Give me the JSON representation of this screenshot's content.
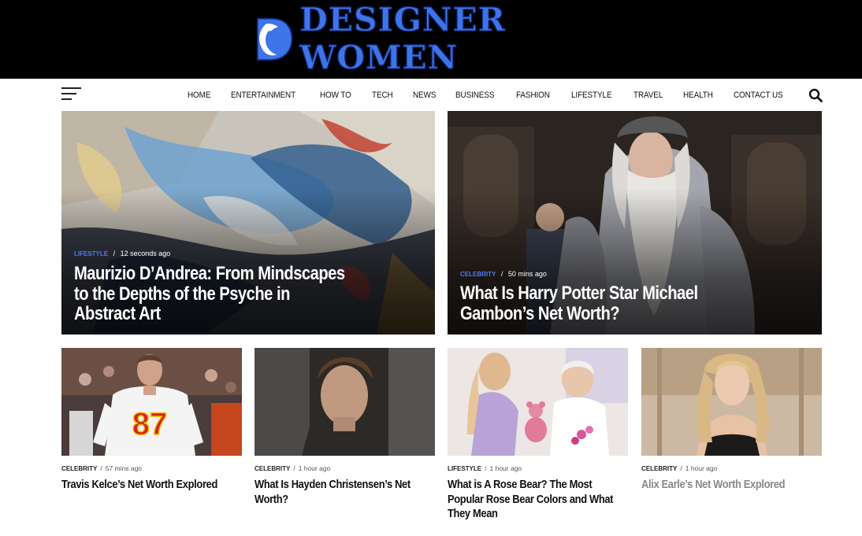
{
  "site": {
    "name": "DESIGNER WOMEN",
    "logo_letter": "D",
    "brand_color": "#3f74e8"
  },
  "nav": {
    "menu_icon": "hamburger-icon",
    "search_icon": "search-icon",
    "items": [
      "HOME",
      "ENTERTAINMENT",
      "HOW TO",
      "TECH",
      "NEWS",
      "BUSINESS",
      "FASHION",
      "LIFESTYLE",
      "TRAVEL",
      "HEALTH",
      "CONTACT US"
    ]
  },
  "featured": [
    {
      "category": "LIFESTYLE",
      "time": "12 seconds ago",
      "title": "Maurizio D’Andrea: From Mindscapes to the Depths of the Psyche in Abstract Art"
    },
    {
      "category": "CELEBRITY",
      "time": "50 mins ago",
      "title": "What Is Harry Potter Star Michael Gambon’s Net Worth?"
    }
  ],
  "posts": [
    {
      "category": "CELEBRITY",
      "time": "57 mins ago",
      "title": "Travis Kelce’s Net Worth Explored",
      "jersey_number": "87"
    },
    {
      "category": "CELEBRITY",
      "time": "1 hour ago",
      "title": "What Is Hayden Christensen’s Net Worth?"
    },
    {
      "category": "LIFESTYLE",
      "time": "1 hour ago",
      "title": "What is A Rose Bear? The Most Popular Rose Bear Colors and What They Mean"
    },
    {
      "category": "CELEBRITY",
      "time": "1 hour ago",
      "title": "Alix Earle’s Net Worth Explored"
    }
  ],
  "colors": {
    "header_bg": "#000000",
    "category_accent": "#4f7bf0"
  }
}
